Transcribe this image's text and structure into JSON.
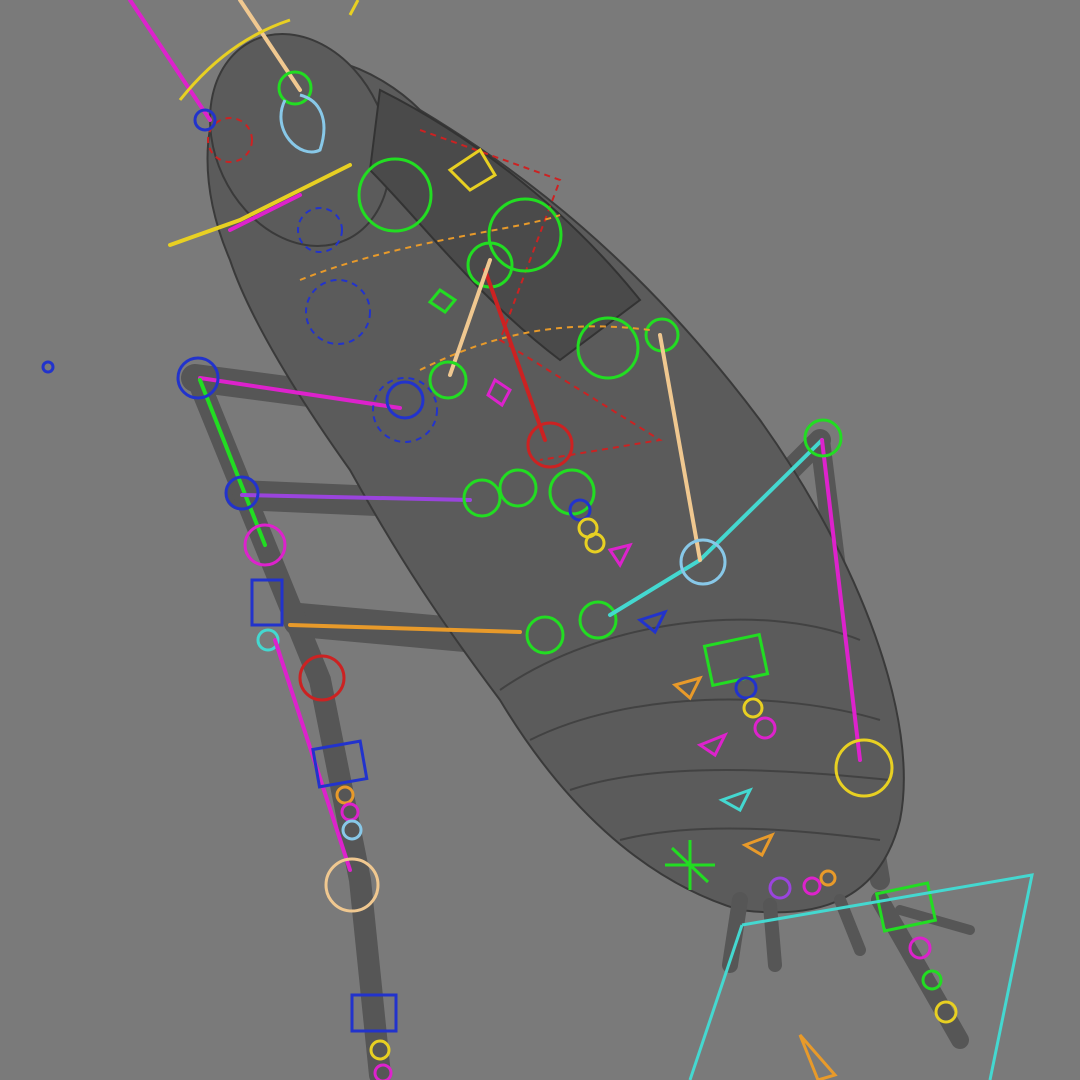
{
  "viewport": {
    "name": "3d-viewport",
    "background": "#7a7a7a"
  },
  "model": {
    "mesh_color": "#5b5b5b"
  },
  "rig_colors": {
    "green": "#22dd22",
    "magenta": "#dd22cc",
    "blue": "#2233cc",
    "yellow": "#e8d022",
    "orange": "#e89a2a",
    "cyan": "#44d8d0",
    "red": "#cc2222",
    "lightblue": "#88c8e8",
    "peach": "#f0c890",
    "purple": "#9a44dd"
  },
  "gizmos": {
    "locator_icon": "axis-cross",
    "cone_icon": "orange-cone"
  }
}
